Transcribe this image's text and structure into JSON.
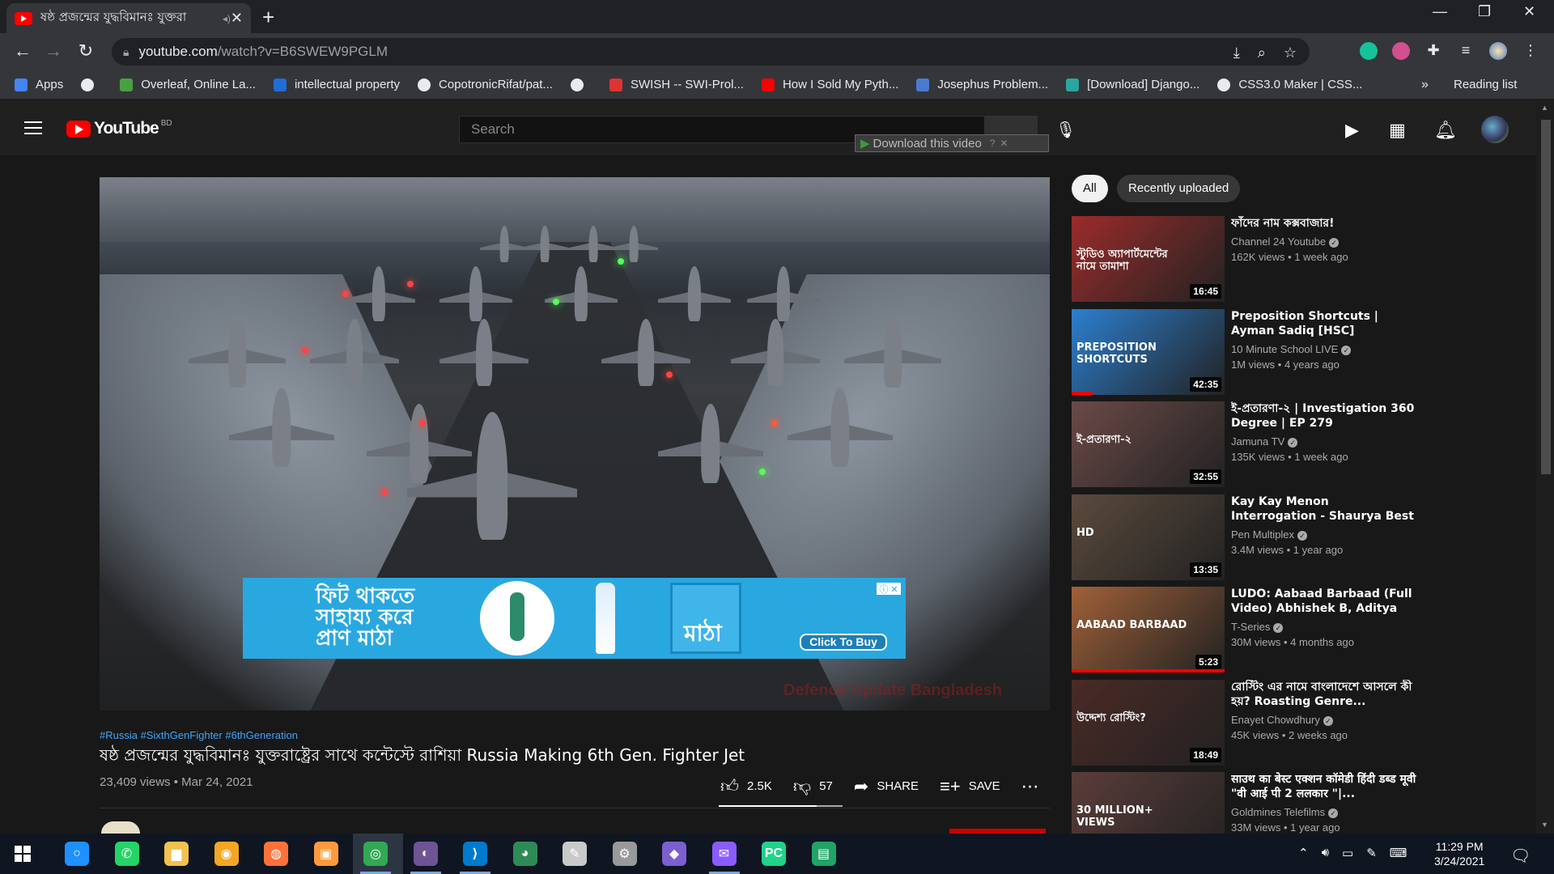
{
  "browser": {
    "tab_title": "ষষ্ঠ প্রজন্মের যুদ্ধবিমানঃ যুক্তরা",
    "url_host": "youtube.com",
    "url_path": "/watch?v=B6SWEW9PGLM",
    "bookmarks": [
      {
        "label": "Apps",
        "color": "#4285f4"
      },
      {
        "label": "",
        "color": "#e8eaed"
      },
      {
        "label": "Overleaf, Online La...",
        "color": "#47a141"
      },
      {
        "label": "intellectual property",
        "color": "#1e6ed6"
      },
      {
        "label": "CopotronicRifat/pat...",
        "color": "#e8eaed"
      },
      {
        "label": "",
        "color": "#e8eaed"
      },
      {
        "label": "SWISH -- SWI-Prol...",
        "color": "#d33"
      },
      {
        "label": "How I Sold My Pyth...",
        "color": "#ff0000"
      },
      {
        "label": "Josephus Problem...",
        "color": "#4a7bd0"
      },
      {
        "label": "[Download] Django...",
        "color": "#2aa6a0"
      },
      {
        "label": "CSS3.0 Maker | CSS...",
        "color": "#e8eaed"
      }
    ],
    "bookmarks_more": "»",
    "reading_list": "Reading list"
  },
  "youtube": {
    "logo_text": "YouTube",
    "country_code": "BD",
    "search_placeholder": "Search",
    "download_overlay": "Download this video",
    "icons": [
      "create-video-icon",
      "apps-grid-icon",
      "notifications-bell-icon"
    ]
  },
  "video": {
    "watermark": "Defence Update Bangladesh",
    "hashtags": "#Russia #SixthGenFighter #6thGeneration",
    "title": "ষষ্ঠ প্রজন্মের যুদ্ধবিমানঃ যুক্তরাষ্ট্রের সাথে কন্টেস্টে রাশিয়া Russia Making 6th Gen. Fighter Jet",
    "views_date": "23,409 views • Mar 24, 2021",
    "likes": "2.5K",
    "dislikes": "57",
    "share": "SHARE",
    "save": "SAVE",
    "like_ratio": 0.79
  },
  "ad": {
    "headline": "ফিট থাকতে সাহায্য করে প্রাণ মাঠা",
    "brand": "প্রাণ",
    "product": "মাঠা",
    "cta": "Click To Buy"
  },
  "chips": {
    "all": "All",
    "recent": "Recently uploaded"
  },
  "recommendations": [
    {
      "title": "ফাঁদের নাম কক্সবাজার!",
      "channel": "Channel 24 Youtube",
      "meta": "162K views • 1 week ago",
      "duration": "16:45",
      "one_line": true,
      "thumb": "#9c2b2b",
      "thumb_caption": "স্টুডিও অ্যাপার্টমেন্টের নামে তামাশা"
    },
    {
      "title": "Preposition Shortcuts | Ayman Sadiq [HSC]",
      "channel": "10 Minute School LIVE",
      "meta": "1M views • 4 years ago",
      "duration": "42:35",
      "one_line": false,
      "thumb": "#2c7fd0",
      "thumb_caption": "PREPOSITION SHORTCUTS"
    },
    {
      "title": "ই-প্রতারণা-২ | Investigation 360 Degree | EP 279",
      "channel": "Jamuna TV",
      "meta": "135K views • 1 week ago",
      "duration": "32:55",
      "one_line": false,
      "thumb": "#6b4a48",
      "thumb_caption": "ই-প্রতারণা-২"
    },
    {
      "title": "Kay Kay Menon Interrogation - Shaurya Best Scene | Full Hind...",
      "channel": "Pen Multiplex",
      "meta": "3.4M views • 1 year ago",
      "duration": "13:35",
      "one_line": false,
      "thumb": "#5b4a3d",
      "thumb_caption": "HD"
    },
    {
      "title": "LUDO: Aabaad Barbaad (Full Video) Abhishek B, Aditya K,...",
      "channel": "T-Series",
      "meta": "30M views • 4 months ago",
      "duration": "5:23",
      "one_line": false,
      "thumb": "#a06038",
      "thumb_caption": "AABAAD BARBAAD"
    },
    {
      "title": "রোস্টিং এর নামে বাংলাদেশে আসলে কী হয়? Roasting Genre...",
      "channel": "Enayet Chowdhury",
      "meta": "45K views • 2 weeks ago",
      "duration": "18:49",
      "one_line": false,
      "thumb": "#4a2a26",
      "thumb_caption": "উদ্দেশ্য রোস্টিং?"
    },
    {
      "title": "साउथ का बेस्ट एक्शन कॉमेडी हिंदी डब्ड मूवी \"वी आई पी 2 ललकार \"|...",
      "channel": "Goldmines Telefilms",
      "meta": "33M views • 1 year ago",
      "duration": "",
      "one_line": false,
      "thumb": "#5a3d3a",
      "thumb_caption": "30 MILLION+ VIEWS"
    }
  ],
  "taskbar": {
    "time": "11:29 PM",
    "date": "3/24/2021",
    "apps": [
      {
        "name": "cortana-icon",
        "color": "#1e90ff",
        "glyph": "○"
      },
      {
        "name": "whatsapp-icon",
        "color": "#25d366",
        "glyph": "✆"
      },
      {
        "name": "file-explorer-icon",
        "color": "#f2c14e",
        "glyph": "▆"
      },
      {
        "name": "brave-icon",
        "color": "#f5a623",
        "glyph": "◉"
      },
      {
        "name": "firefox-icon",
        "color": "#ff7139",
        "glyph": "◍"
      },
      {
        "name": "photo-app-icon",
        "color": "#ff9a3c",
        "glyph": "▣"
      },
      {
        "name": "chrome-icon",
        "color": "#34a853",
        "glyph": "◎"
      },
      {
        "name": "github-icon",
        "color": "#6e5494",
        "glyph": "◐"
      },
      {
        "name": "vscode-icon",
        "color": "#007acc",
        "glyph": "⟩"
      },
      {
        "name": "maps-app-icon",
        "color": "#2e8b57",
        "glyph": "◕"
      },
      {
        "name": "paint-icon",
        "color": "#c9c9c9",
        "glyph": "✎"
      },
      {
        "name": "settings-app-icon",
        "color": "#999",
        "glyph": "⚙"
      },
      {
        "name": "visual-studio-icon",
        "color": "#7b5fd0",
        "glyph": "◆"
      },
      {
        "name": "messenger-icon",
        "color": "#8a5cff",
        "glyph": "✉"
      },
      {
        "name": "pycharm-icon",
        "color": "#1fd38a",
        "glyph": "PC"
      },
      {
        "name": "excel-icon",
        "color": "#21a366",
        "glyph": "▤"
      }
    ]
  },
  "colors": {
    "youtube_red": "#ff0000",
    "link_blue": "#3ea6ff",
    "ad_blue": "#29a8e0"
  }
}
